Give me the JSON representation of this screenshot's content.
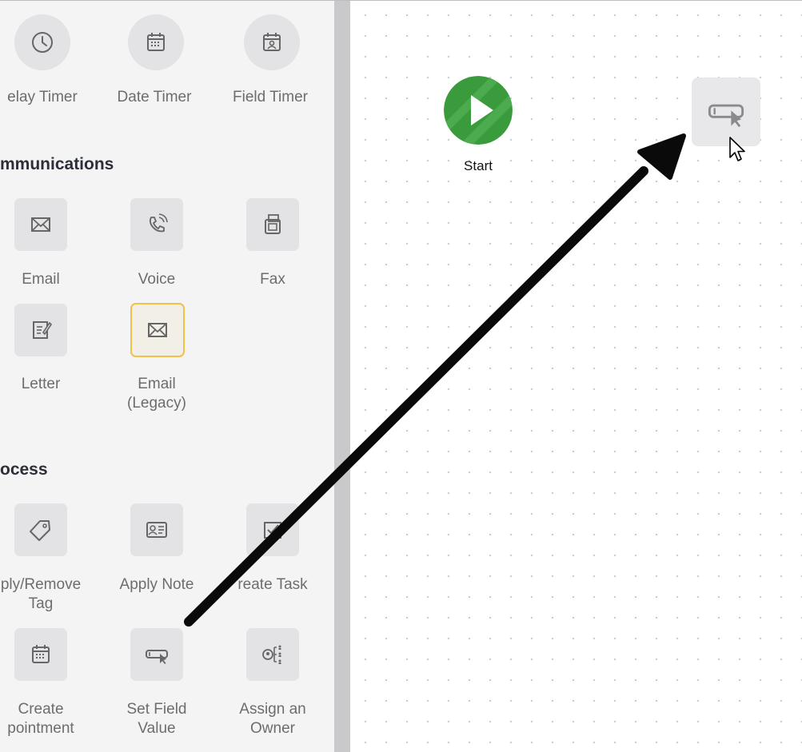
{
  "sidebar": {
    "timers": [
      "elay Timer",
      "Date Timer",
      "Field Timer"
    ],
    "communications_title": "mmunications",
    "communications": [
      "Email",
      "Voice",
      "Fax",
      "Letter",
      "Email\n(Legacy)"
    ],
    "process_title": "ocess",
    "process": [
      "ply/Remove\nTag",
      "Apply Note",
      "reate Task",
      "Create\npointment",
      "Set Field\nValue",
      "Assign an\nOwner"
    ]
  },
  "canvas": {
    "start_label": "Start"
  },
  "colors": {
    "start_green": "#3a9b3c",
    "selected_border": "#f0c24a",
    "arrow": "#0a0a0a"
  }
}
